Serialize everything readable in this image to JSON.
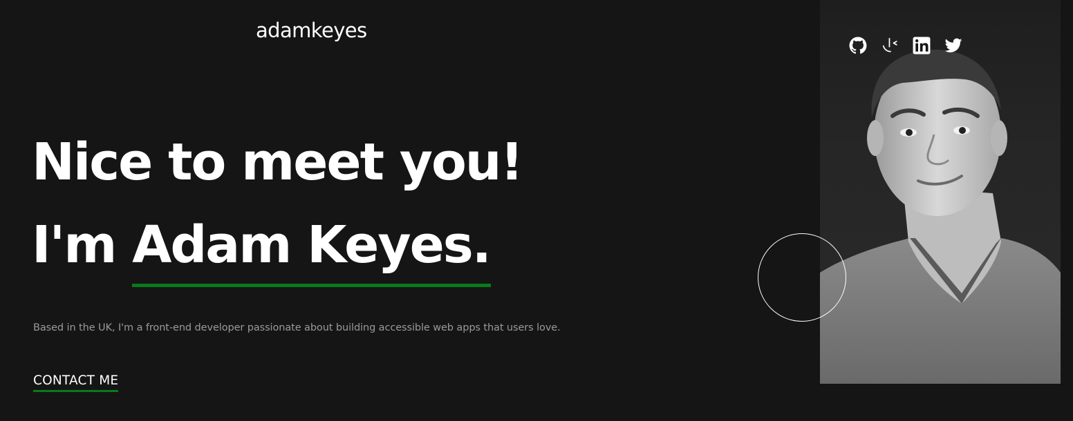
{
  "header": {
    "logo_text": "adamkeyes"
  },
  "socials": [
    {
      "icon": "github-icon"
    },
    {
      "icon": "frontend-mentor-icon"
    },
    {
      "icon": "linkedin-icon"
    },
    {
      "icon": "twitter-icon"
    }
  ],
  "hero": {
    "line1": "Nice to meet you!",
    "line2_prefix": "I'm ",
    "name": "Adam Keyes.",
    "intro": "Based in the UK, I'm a front-end developer passionate about building accessible web apps that users love.",
    "cta_label": "CONTACT ME"
  },
  "colors": {
    "background": "#151515",
    "accent": "#0a7a1a",
    "text": "#ffffff",
    "muted": "#9a9a9a"
  }
}
